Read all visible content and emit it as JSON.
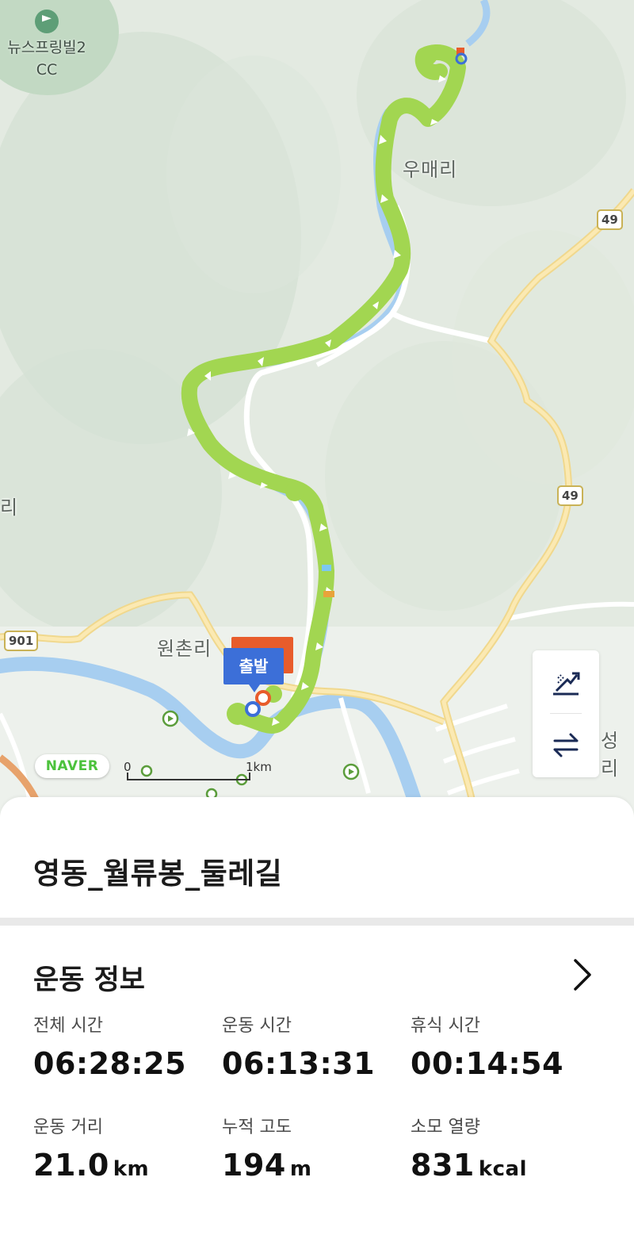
{
  "map": {
    "places": {
      "umae": "우매리",
      "wonchon": "원촌리",
      "golf_line1": "뉴스프링빌2",
      "golf_line2": "CC",
      "edge_left": "리",
      "edge_right": "성리"
    },
    "route_badges": [
      "49",
      "49",
      "901"
    ],
    "start_label": "출발",
    "naver_logo": "NAVER",
    "scale": {
      "zero": "0",
      "label": "1km"
    },
    "controls": [
      "elevation-profile-icon",
      "swap-arrows-icon"
    ],
    "colors": {
      "track": "#a2d651",
      "river": "#a7cef0",
      "road": "#f6dc98",
      "start_tag": "#3c6fd8",
      "end_tag": "#e85c2b"
    }
  },
  "course": {
    "title": "영동_월류봉_둘레길"
  },
  "exercise": {
    "heading": "운동 정보",
    "stats": [
      {
        "label": "전체 시간",
        "value": "06:28:25",
        "unit": ""
      },
      {
        "label": "운동 시간",
        "value": "06:13:31",
        "unit": ""
      },
      {
        "label": "휴식 시간",
        "value": "00:14:54",
        "unit": ""
      },
      {
        "label": "운동 거리",
        "value": "21.0",
        "unit": "km"
      },
      {
        "label": "누적 고도",
        "value": "194",
        "unit": "m"
      },
      {
        "label": "소모 열량",
        "value": "831",
        "unit": "kcal"
      }
    ]
  }
}
